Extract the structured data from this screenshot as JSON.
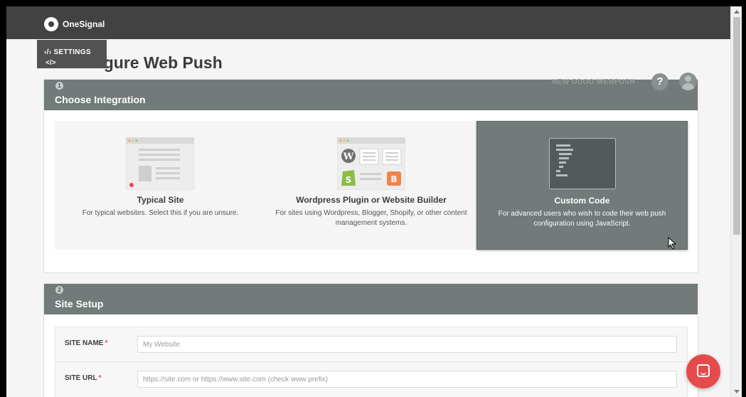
{
  "app": {
    "logo_text": "OneSignal"
  },
  "settings_chip": {
    "label": "SETTINGS",
    "code_glyph": "</>"
  },
  "page": {
    "title": "Configure Web Push"
  },
  "header_right": {
    "app_name": "NEW ODOO WEBPUSH",
    "help": "?"
  },
  "integration": {
    "step": "1",
    "title": "Choose Integration",
    "options": [
      {
        "title": "Typical Site",
        "description": "For typical websites. Select this if you are unsure."
      },
      {
        "title": "Wordpress Plugin or Website Builder",
        "description": "For sites using Wordpress, Blogger, Shopify, or other content management systems."
      },
      {
        "title": "Custom Code",
        "description": "For advanced users who wish to code their web push configuration using JavaScript."
      }
    ],
    "selected_option": "Custom Code"
  },
  "site_setup": {
    "step": "2",
    "title": "Site Setup",
    "fields": [
      {
        "label": "SITE NAME",
        "required_mark": "*",
        "placeholder": "My Website"
      },
      {
        "label": "SITE URL",
        "required_mark": "*",
        "placeholder": "https://site.com or https://www.site.com (check www prefix)"
      }
    ]
  },
  "colors": {
    "topbar": "#424242",
    "card_header": "#727a7a",
    "accent_red": "#e54b4d"
  },
  "icons": [
    "onesignal-logo-icon",
    "code-icon",
    "help-icon",
    "avatar-icon",
    "chat-icon",
    "cursor-icon"
  ]
}
